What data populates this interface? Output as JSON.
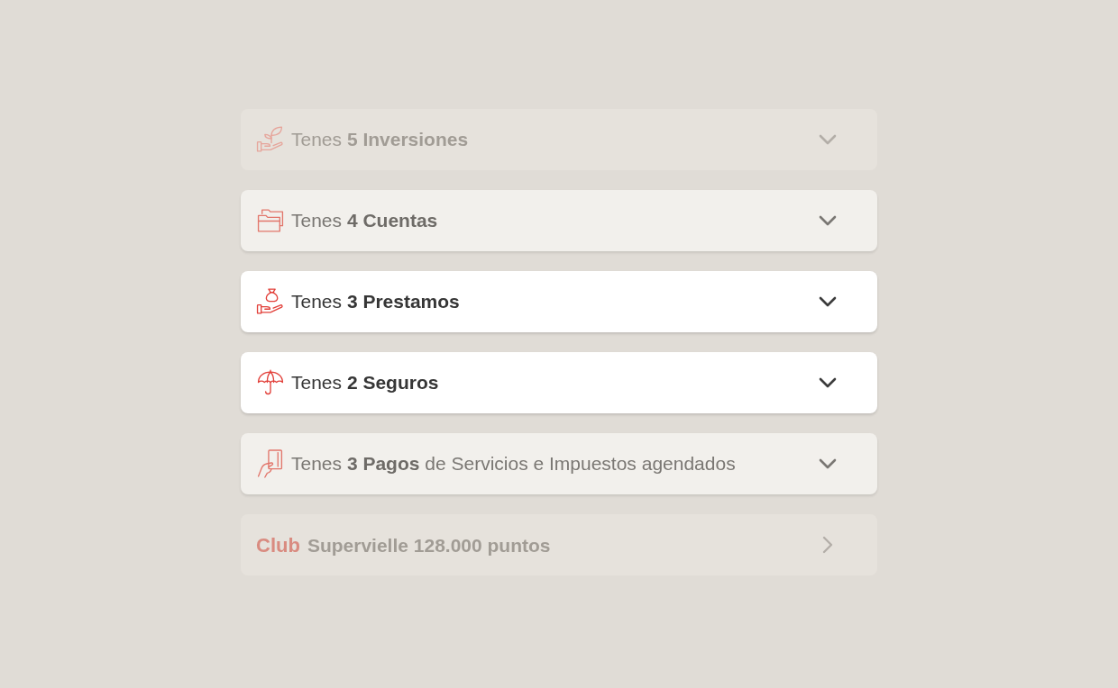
{
  "items": [
    {
      "kind": "accordion",
      "disabled": true,
      "highlighted": false,
      "expanded": false,
      "label": "Tenes **5 Inversiones**"
    },
    {
      "kind": "accordion",
      "disabled": false,
      "highlighted": false,
      "expanded": false,
      "label": "Tenes **4 Cuentas**"
    },
    {
      "kind": "accordion",
      "disabled": false,
      "highlighted": true,
      "expanded": false,
      "label": "Tenes **3 Prestamos**"
    },
    {
      "kind": "accordion",
      "disabled": false,
      "highlighted": true,
      "expanded": false,
      "label": "Tenes **2 Seguros**"
    },
    {
      "kind": "accordion",
      "disabled": false,
      "highlighted": false,
      "expanded": false,
      "label": "Tenes **3 Pagos** de Servicios e Impuestos agendados"
    },
    {
      "kind": "link",
      "disabled": true,
      "highlighted": false,
      "brand": "Club",
      "label": "Supervielle 128.000 puntos"
    }
  ]
}
